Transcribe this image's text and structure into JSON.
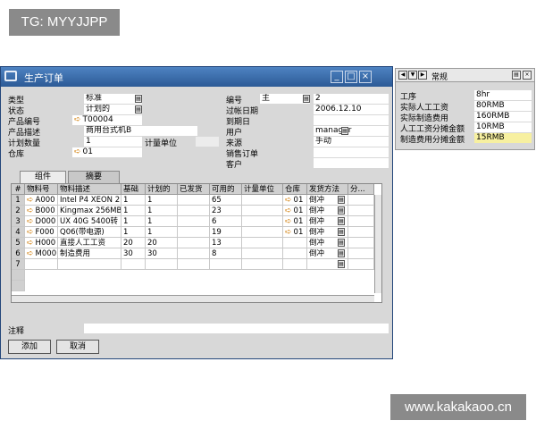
{
  "watermarks": {
    "top_left": "TG: MYYJJPP",
    "bottom_right": "www.kakakaoo.cn"
  },
  "window": {
    "title": "生产订单"
  },
  "header": {
    "type_label": "类型",
    "type_value": "标准",
    "status_label": "状态",
    "status_value": "计划的",
    "product_no_label": "产品编号",
    "product_no_value": "T00004",
    "product_desc_label": "产品描述",
    "product_desc_value": "商用台式机B",
    "planned_qty_label": "计划数量",
    "planned_qty_value": "1",
    "uom_label": "计量单位",
    "uom_value": "",
    "warehouse_label": "仓库",
    "warehouse_value": "01",
    "number_label": "编号",
    "number_series": "主",
    "number_value": "2",
    "posting_date_label": "过帐日期",
    "posting_date_value": "2006.12.10",
    "due_date_label": "到期日",
    "due_date_value": "",
    "user_label": "用户",
    "user_value": "manager",
    "origin_label": "来源",
    "origin_value": "手动",
    "sales_order_label": "销售订单",
    "sales_order_value": "",
    "customer_label": "客户",
    "customer_value": ""
  },
  "tabs": [
    {
      "label": "组件"
    },
    {
      "label": "摘要"
    }
  ],
  "grid": {
    "columns": [
      "#",
      "物料号",
      "物料描述",
      "基础",
      "计划的",
      "已发货",
      "可用的",
      "计量单位",
      "仓库",
      "发货方法",
      "分..."
    ],
    "rows": [
      {
        "n": "1",
        "item": "A000",
        "desc": "Intel P4 XEON 2",
        "base": "1",
        "planned": "1",
        "issued": "",
        "available": "65",
        "uom": "",
        "whs": "01",
        "method": "倒冲"
      },
      {
        "n": "2",
        "item": "B000",
        "desc": "Kingmax 256MB",
        "base": "1",
        "planned": "1",
        "issued": "",
        "available": "23",
        "uom": "",
        "whs": "01",
        "method": "倒冲"
      },
      {
        "n": "3",
        "item": "D000",
        "desc": "UX 40G 5400转",
        "base": "1",
        "planned": "1",
        "issued": "",
        "available": "6",
        "uom": "",
        "whs": "01",
        "method": "倒冲"
      },
      {
        "n": "4",
        "item": "F000",
        "desc": "Q06(带电源)",
        "base": "1",
        "planned": "1",
        "issued": "",
        "available": "19",
        "uom": "",
        "whs": "01",
        "method": "倒冲"
      },
      {
        "n": "5",
        "item": "H000",
        "desc": "直接人工工资",
        "base": "20",
        "planned": "20",
        "issued": "",
        "available": "13",
        "uom": "",
        "whs": "",
        "method": "倒冲"
      },
      {
        "n": "6",
        "item": "M000",
        "desc": "制造费用",
        "base": "30",
        "planned": "30",
        "issued": "",
        "available": "8",
        "uom": "",
        "whs": "",
        "method": "倒冲"
      },
      {
        "n": "7",
        "item": "",
        "desc": "",
        "base": "",
        "planned": "",
        "issued": "",
        "available": "",
        "uom": "",
        "whs": "",
        "method": ""
      }
    ]
  },
  "remarks_label": "注释",
  "buttons": {
    "add": "添加",
    "cancel": "取消"
  },
  "side_panel": {
    "title": "常规",
    "rows": [
      {
        "label": "工序",
        "value": "8hr"
      },
      {
        "label": "实际人工工资",
        "value": "80RMB"
      },
      {
        "label": "实际制造费用",
        "value": "160RMB"
      },
      {
        "label": "人工工资分摊金额",
        "value": "10RMB"
      },
      {
        "label": "制造费用分摊金额",
        "value": "15RMB"
      }
    ],
    "highlight_color": "#f7f0a0"
  }
}
